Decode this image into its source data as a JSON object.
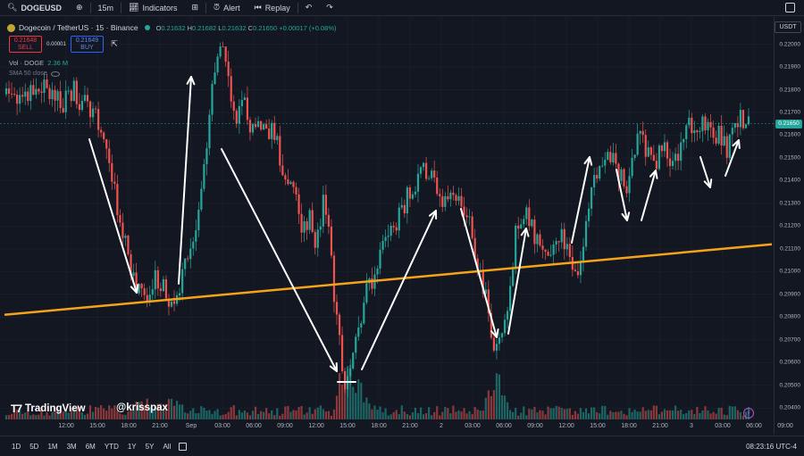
{
  "toolbar": {
    "symbol": "DOGEUSD",
    "interval": "15m",
    "indicators_label": "Indicators",
    "alert_label": "Alert",
    "replay_label": "Replay"
  },
  "legend": {
    "title": "Dogecoin / TetherUS · 15 · Binance",
    "open_key": "O",
    "open": "0.21632",
    "high_key": "H",
    "high": "0.21682",
    "low_key": "L",
    "low": "0.21632",
    "close_key": "C",
    "close": "0.21650",
    "change": "+0.00017 (+0.08%)"
  },
  "trade": {
    "sell_price": "0.21648",
    "sell_label": "SELL",
    "spread": "0.00001",
    "buy_price": "0.21649",
    "buy_label": "BUY"
  },
  "volume_legend": {
    "label": "Vol · DOGE",
    "value": "2.36 M"
  },
  "sma_legend": {
    "label": "SMA 50 close"
  },
  "currency": "USDT",
  "current_price": "0.21650",
  "price_axis": [
    "0.22000",
    "0.21900",
    "0.21800",
    "0.21700",
    "0.21600",
    "0.21500",
    "0.21400",
    "0.21300",
    "0.21200",
    "0.21100",
    "0.21000",
    "0.20900",
    "0.20800",
    "0.20700",
    "0.20600",
    "0.20500",
    "0.20400"
  ],
  "time_axis": [
    "12:00",
    "15:00",
    "18:00",
    "21:00",
    "Sep",
    "03:00",
    "06:00",
    "09:00",
    "12:00",
    "15:00",
    "18:00",
    "21:00",
    "2",
    "03:00",
    "06:00",
    "09:00",
    "12:00",
    "15:00",
    "18:00",
    "21:00",
    "3",
    "03:00",
    "06:00",
    "09:00"
  ],
  "watermark": {
    "brand": "TradingView",
    "handle": "@krisspax"
  },
  "ranges": [
    "1D",
    "5D",
    "1M",
    "3M",
    "6M",
    "YTD",
    "1Y",
    "5Y",
    "All"
  ],
  "clock": "08:23:16 UTC-4",
  "colors": {
    "up": "#26a69a",
    "down": "#ef5350",
    "trendline": "#f7a21b",
    "background": "#131722"
  },
  "chart_data": {
    "type": "candlestick",
    "y_range": [
      0.2035,
      0.2212
    ],
    "support_line": {
      "start": 0.2081,
      "end": 0.2112
    },
    "current_price": 0.2165,
    "path": [
      0.2178,
      0.2182,
      0.2174,
      0.218,
      0.2176,
      0.2181,
      0.2177,
      0.2179,
      0.2175,
      0.218,
      0.2177,
      0.2174,
      0.2172,
      0.2163,
      0.215,
      0.2135,
      0.2118,
      0.2104,
      0.2094,
      0.2088,
      0.2092,
      0.2098,
      0.209,
      0.2086,
      0.2094,
      0.2104,
      0.2118,
      0.213,
      0.216,
      0.219,
      0.2199,
      0.2178,
      0.2168,
      0.2172,
      0.2163,
      0.217,
      0.2158,
      0.2162,
      0.215,
      0.214,
      0.2132,
      0.2122,
      0.2124,
      0.2114,
      0.213,
      0.211,
      0.2072,
      0.2052,
      0.2058,
      0.2074,
      0.209,
      0.21,
      0.211,
      0.2112,
      0.2122,
      0.2128,
      0.2136,
      0.214,
      0.2146,
      0.2142,
      0.2137,
      0.213,
      0.2138,
      0.2132,
      0.2125,
      0.211,
      0.2098,
      0.208,
      0.2064,
      0.2072,
      0.21,
      0.2122,
      0.2128,
      0.212,
      0.2108,
      0.2103,
      0.2112,
      0.2116,
      0.2105,
      0.21,
      0.211,
      0.213,
      0.2146,
      0.2152,
      0.215,
      0.2142,
      0.2135,
      0.2152,
      0.216,
      0.215,
      0.2146,
      0.2156,
      0.2145,
      0.2152,
      0.216,
      0.2164,
      0.216,
      0.2167,
      0.2163,
      0.2158,
      0.2155,
      0.2167,
      0.2169,
      0.2165
    ]
  }
}
